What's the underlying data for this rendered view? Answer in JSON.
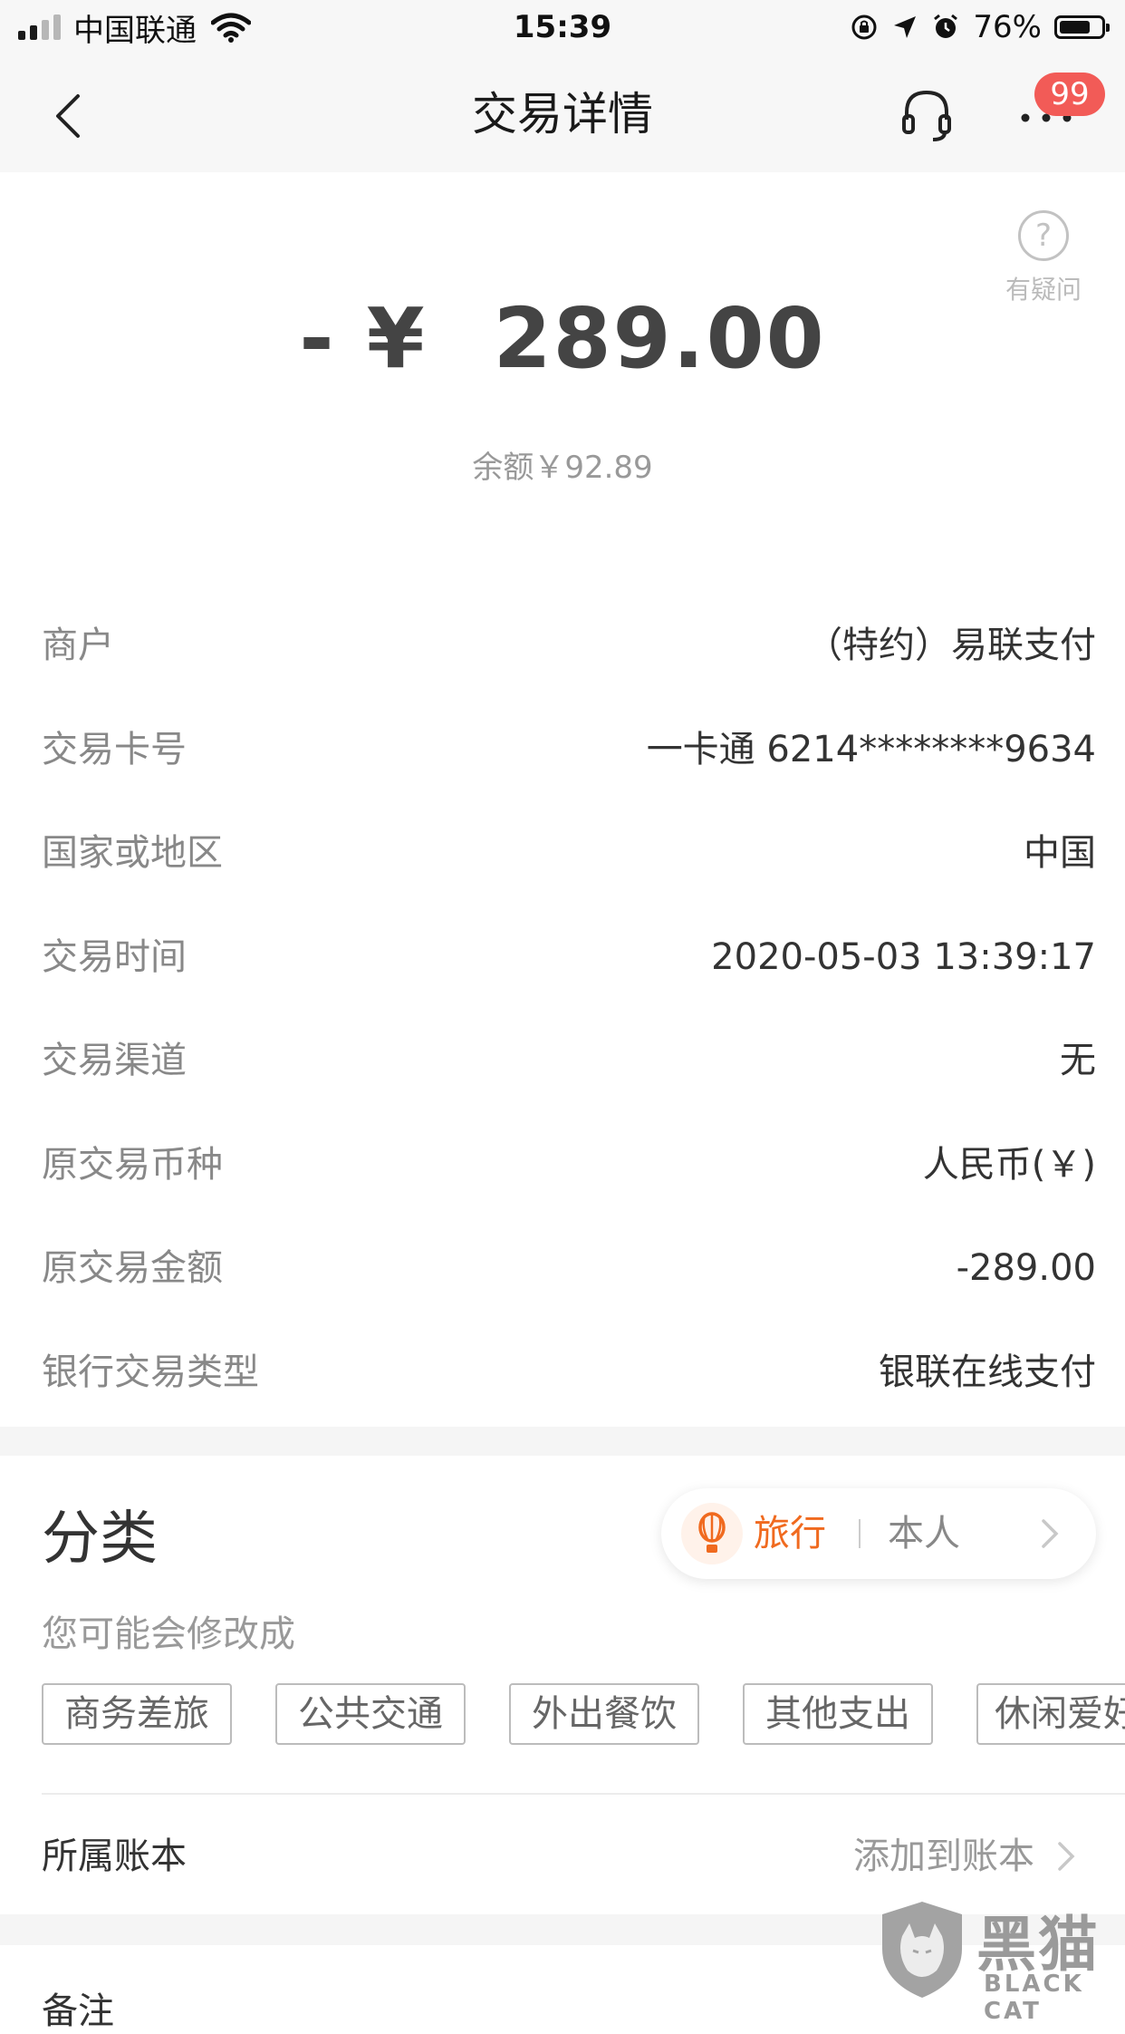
{
  "status_bar": {
    "carrier": "中国联通",
    "time": "15:39",
    "battery_percent": "76%",
    "battery_level": 0.76,
    "icons": [
      "signal-icon",
      "wifi-icon",
      "orientation-lock-icon",
      "location-icon",
      "alarm-icon",
      "battery-icon"
    ]
  },
  "nav": {
    "title": "交易详情",
    "back_icon": "back-icon",
    "support_icon": "headset-icon",
    "more_icon": "more-icon",
    "badge_count": "99"
  },
  "help": {
    "label": "有疑问",
    "icon": "question-icon"
  },
  "summary": {
    "sign": "-",
    "currency": "¥",
    "amount": "289.00",
    "balance": "余额￥92.89"
  },
  "details": [
    {
      "label": "商户",
      "value": "（特约）易联支付"
    },
    {
      "label": "交易卡号",
      "value": "一卡通 6214********9634"
    },
    {
      "label": "国家或地区",
      "value": "中国"
    },
    {
      "label": "交易时间",
      "value": "2020-05-03 13:39:17"
    },
    {
      "label": "交易渠道",
      "value": "无"
    },
    {
      "label": "原交易币种",
      "value": "人民币(￥)"
    },
    {
      "label": "原交易金额",
      "value": "-289.00"
    },
    {
      "label": "银行交易类型",
      "value": "银联在线支付"
    }
  ],
  "category": {
    "title": "分类",
    "current": "旅行",
    "owner": "本人",
    "icon": "balloon-icon",
    "accent_color": "#f06a1f",
    "suggest_label": "您可能会修改成",
    "suggestions": [
      "商务差旅",
      "公共交通",
      "外出餐饮",
      "其他支出",
      "休闲爱好"
    ]
  },
  "ledger": {
    "label": "所属账本",
    "action": "添加到账本"
  },
  "notes": {
    "label": "备注"
  },
  "watermark": {
    "cn": "黑猫",
    "en": "BLACK CAT"
  },
  "colors": {
    "badge": "#f25b57",
    "accent": "#f06a1f",
    "nav_bg": "#f7f7f7"
  }
}
